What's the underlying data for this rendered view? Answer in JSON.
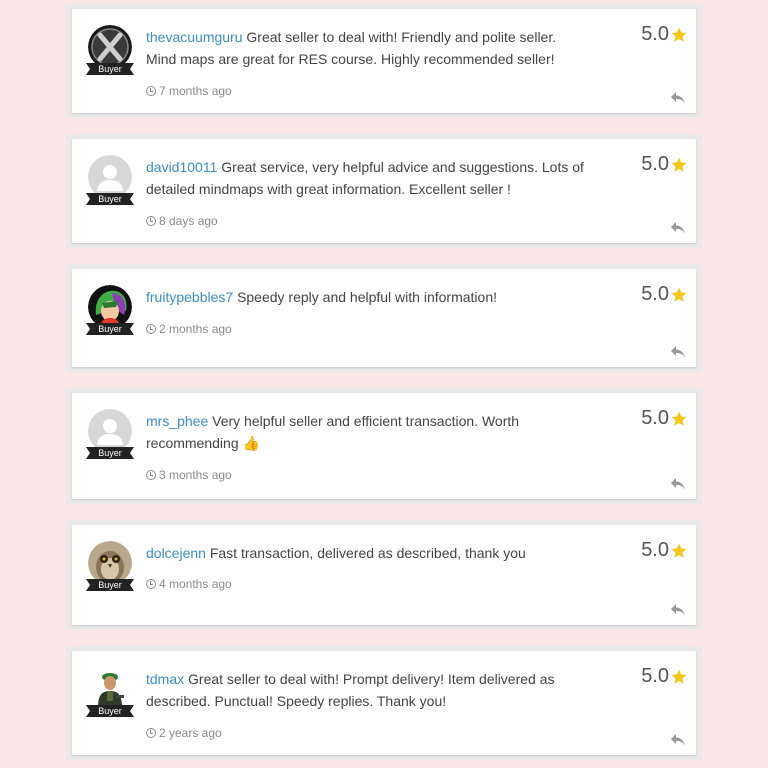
{
  "reviews": [
    {
      "username": "thevacuumguru",
      "text": "Great seller to deal with! Friendly and polite seller. Mind maps are great for RES course. Highly recommended seller!",
      "emoji": "",
      "time": "7 months ago",
      "rating": "5.0",
      "badge": "Buyer",
      "avatar": "x-logo-icon"
    },
    {
      "username": "david10011",
      "text": "Great service, very helpful advice and suggestions. Lots of detailed mindmaps with great information. Excellent seller !",
      "emoji": "",
      "time": "8 days ago",
      "rating": "5.0",
      "badge": "Buyer",
      "avatar": "default-user-icon"
    },
    {
      "username": "fruitypebbles7",
      "text": "Speedy reply and helpful with information!",
      "emoji": "",
      "time": "2 months ago",
      "rating": "5.0",
      "badge": "Buyer",
      "avatar": "cartoon-character-icon"
    },
    {
      "username": "mrs_phee",
      "text": "Very helpful seller and efficient transaction. Worth recommending",
      "emoji": "👍",
      "time": "3 months ago",
      "rating": "5.0",
      "badge": "Buyer",
      "avatar": "default-user-icon"
    },
    {
      "username": "dolcejenn",
      "text": "Fast transaction, delivered as described, thank you",
      "emoji": "",
      "time": "4 months ago",
      "rating": "5.0",
      "badge": "Buyer",
      "avatar": "owl-photo-icon"
    },
    {
      "username": "tdmax",
      "text": "Great seller to deal with! Prompt delivery! Item delivered as described. Punctual! Speedy replies. Thank you!",
      "emoji": "",
      "time": "2 years ago",
      "rating": "5.0",
      "badge": "Buyer",
      "avatar": "soldier-figure-icon"
    }
  ],
  "colors": {
    "page_background": "#fae6e6",
    "username_link": "#3a8fc4",
    "star": "#f5c518",
    "badge_background": "#222222"
  }
}
